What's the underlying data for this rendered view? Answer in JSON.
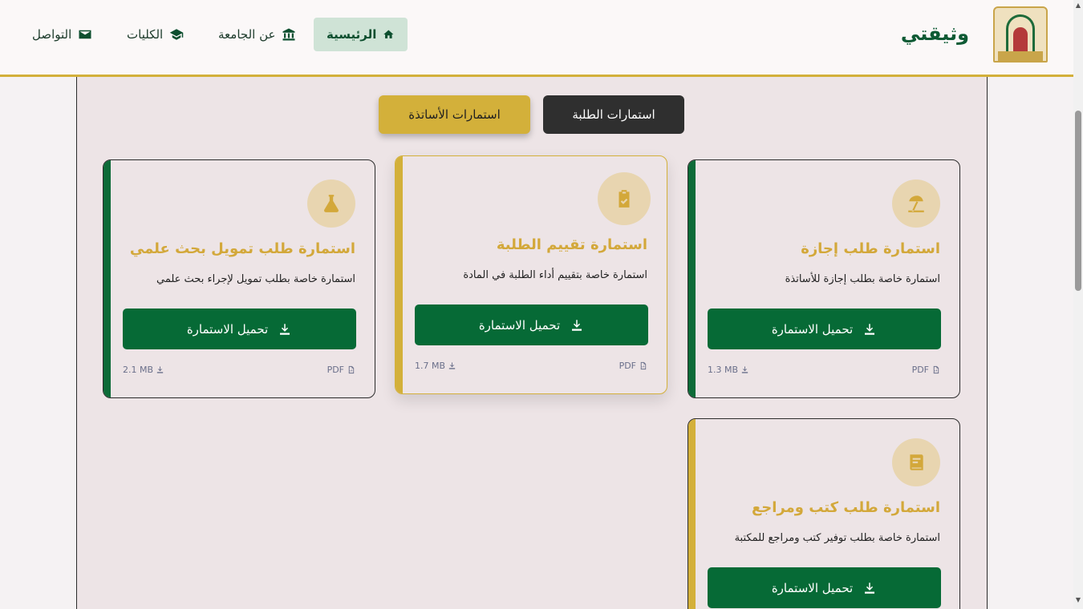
{
  "header": {
    "brand": "وثيقتي",
    "nav": [
      {
        "label": "الرئيسية",
        "icon": "home-icon"
      },
      {
        "label": "عن الجامعة",
        "icon": "university-icon"
      },
      {
        "label": "الكليات",
        "icon": "graduation-cap-icon"
      },
      {
        "label": "التواصل",
        "icon": "envelope-icon"
      }
    ]
  },
  "tabs": {
    "teachers": "استمارات الأساتذة",
    "students": "استمارات الطلبة"
  },
  "cards": [
    {
      "title": "استمارة طلب إجازة",
      "desc": "استمارة خاصة بطلب إجازة للأساتذة",
      "button": "تحميل الاستمارة",
      "type": "PDF",
      "size": "1.3 MB",
      "icon": "beach-umbrella-icon"
    },
    {
      "title": "استمارة تقييم الطلبة",
      "desc": "استمارة خاصة بتقييم أداء الطلبة في المادة",
      "button": "تحميل الاستمارة",
      "type": "PDF",
      "size": "1.7 MB",
      "icon": "clipboard-check-icon"
    },
    {
      "title": "استمارة طلب تمويل بحث علمي",
      "desc": "استمارة خاصة بطلب تمويل لإجراء بحث علمي",
      "button": "تحميل الاستمارة",
      "type": "PDF",
      "size": "2.1 MB",
      "icon": "flask-icon"
    },
    {
      "title": "استمارة طلب كتب ومراجع",
      "desc": "استمارة خاصة بطلب توفير كتب ومراجع للمكتبة",
      "button": "تحميل الاستمارة",
      "type": "",
      "size": "",
      "icon": "book-icon"
    }
  ],
  "colors": {
    "primary": "#066a36",
    "accent": "#d3b03a",
    "dark": "#2f2f2f"
  }
}
